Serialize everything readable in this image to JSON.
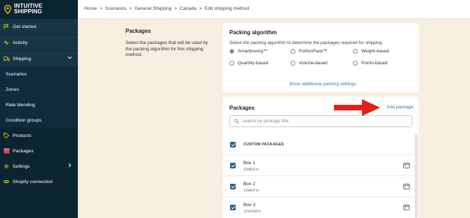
{
  "brand": {
    "line1": "INTUITIVE",
    "line2": "SHIPPING",
    "accent": "#f2c200"
  },
  "sidebar": {
    "items": [
      {
        "label": "Get started",
        "icon": "flag-icon"
      },
      {
        "label": "Activity",
        "icon": "activity-icon"
      },
      {
        "label": "Shipping",
        "icon": "truck-icon"
      },
      {
        "label": "Scenarios"
      },
      {
        "label": "Zones"
      },
      {
        "label": "Rate blending"
      },
      {
        "label": "Condition groups"
      },
      {
        "label": "Products",
        "icon": "tag-icon"
      },
      {
        "label": "Packages",
        "icon": "package-icon"
      },
      {
        "label": "Settings",
        "icon": "gear-icon"
      },
      {
        "label": "Shopify connection",
        "icon": "link-icon"
      }
    ]
  },
  "breadcrumb": {
    "home": "Home",
    "scenarios": "Scenarios",
    "general": "General Shipping",
    "canada": "Canada",
    "current": "Edit shipping method",
    "sep": ">"
  },
  "section": {
    "title": "Packages",
    "description": "Select the packages that will be used by the packing algorithm for this shipping method."
  },
  "algorithm": {
    "title": "Packing algorithm",
    "subtitle": "Select the packing algorithm to determine the packages required for shipping.",
    "options": [
      "Smartboxing™",
      "PortionPack™",
      "Weight-based",
      "Quantity-based",
      "Volume-based",
      "Points-based"
    ],
    "selected": "Smartboxing™",
    "additional_link": "Show additional packing settings"
  },
  "packages": {
    "title": "Packages",
    "add_label": "Add package",
    "search_placeholder": "search by package title",
    "custom_header": "CUSTOM PACKAGES",
    "rows": [
      {
        "name": "Box 1",
        "dims": "10x8x3 in"
      },
      {
        "name": "Box 2",
        "dims": "12x8x3 in"
      },
      {
        "name": "Box 3",
        "dims": "12x10x8 in"
      }
    ]
  },
  "colors": {
    "sidebar": "#0b2432",
    "accent_link": "#2a7bbf",
    "checkbox": "#2b5f86",
    "arrow": "#e0221e",
    "background": "#f6eedf"
  }
}
